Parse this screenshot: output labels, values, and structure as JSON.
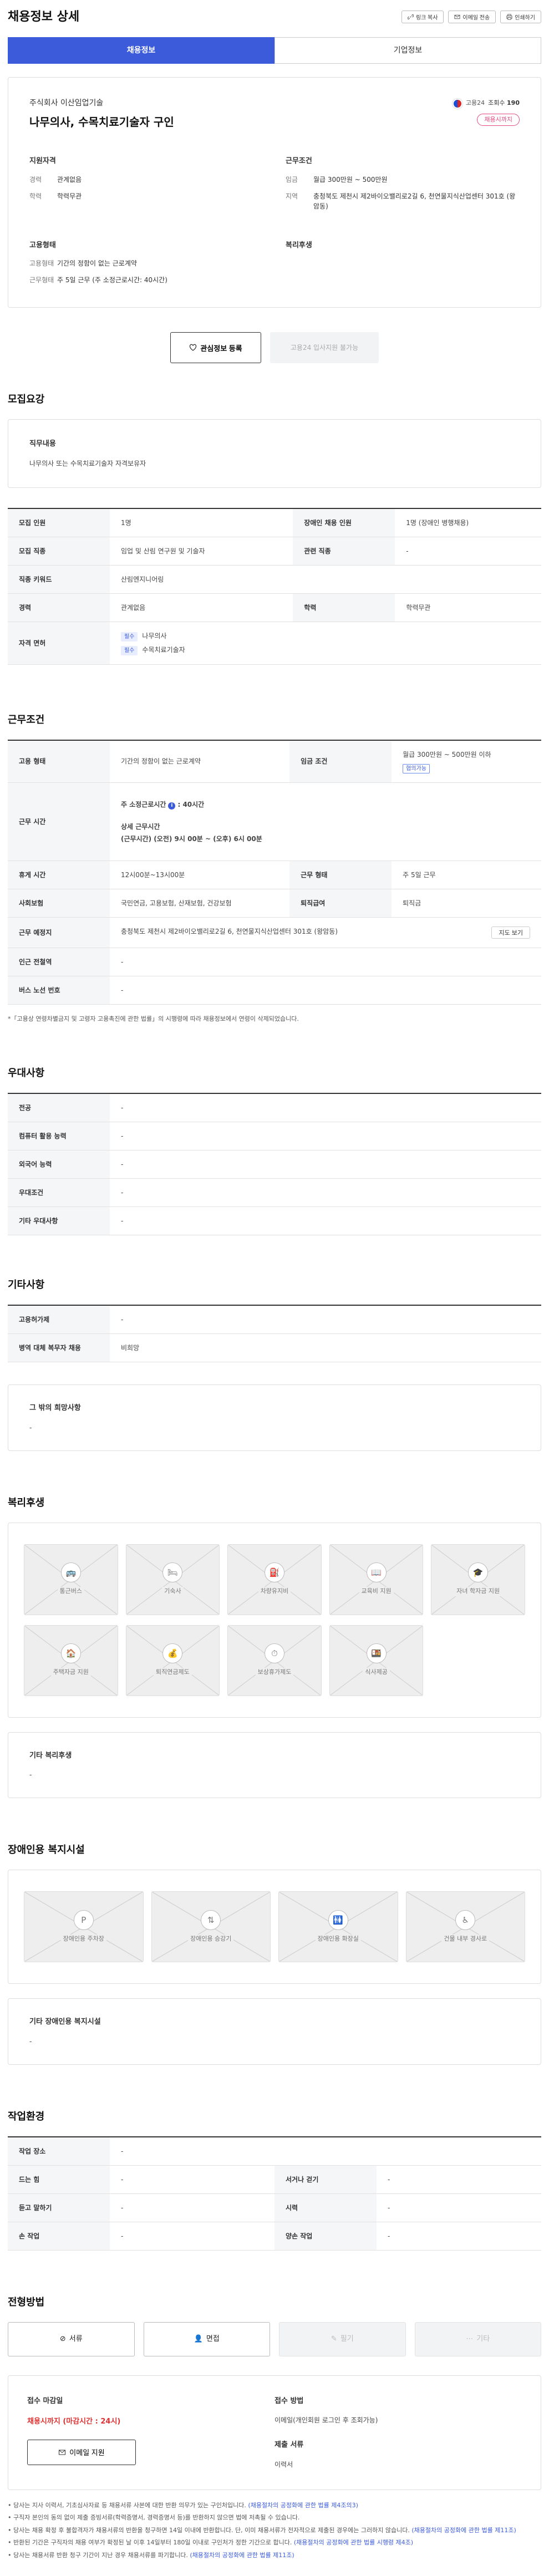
{
  "header": {
    "title": "채용정보 상세",
    "tools": [
      "링크 복사",
      "이메일 전송",
      "인쇄하기"
    ]
  },
  "tabs": [
    "채용정보",
    "기업정보"
  ],
  "summary": {
    "company": "주식회사 이산임업기술",
    "employment_label": "고용24",
    "views_label": "조회수",
    "views": "190",
    "title": "나무의사, 수목치료기술자 구인",
    "badge": "채용시까지",
    "qualification_title": "지원자격",
    "career_k": "경력",
    "career_v": "관계없음",
    "edu_k": "학력",
    "edu_v": "학력무관",
    "conditions_title": "근무조건",
    "wage_k": "임금",
    "wage_v": "월급 300만원 ~ 500만원",
    "region_k": "지역",
    "region_v": "충청북도 제천시 제2바이오밸리로2길 6, 천연물지식산업센터 301호 (왕암동)",
    "emp_title": "고용형태",
    "emptype_k": "고용형태",
    "emptype_v": "기간의 정함이 없는 근로계약",
    "worktype_k": "근무형태",
    "worktype_v": "주 5일 근무 (주 소정근로시간: 40시간)",
    "welfare_title": "복리후생"
  },
  "actions": {
    "favorite": "관심정보 등록",
    "apply24": "고용24 입사지원 불가능"
  },
  "recruit": {
    "section_title": "모집요강",
    "duty_title": "직무내용",
    "duty": "나무의사 또는 수목치료기술자 자격보유자",
    "rows": {
      "count_k": "모집 인원",
      "count_v": "1명",
      "disabled_k": "장애인 채용 인원",
      "disabled_v": "1명 (장애인 병행채용)",
      "job_k": "모집 직종",
      "job_v": "임업 및 산림 연구원 및 기술자",
      "related_k": "관련 직종",
      "related_v": "-",
      "keyword_k": "직종 키워드",
      "keyword_v": "산림엔지니어링",
      "career_k": "경력",
      "career_v": "관계없음",
      "edu_k": "학력",
      "edu_v": "학력무관",
      "license_k": "자격 면허",
      "license_chip": "필수",
      "license_1": "나무의사",
      "license_2": "수목치료기술자"
    }
  },
  "work": {
    "section_title": "근무조건",
    "type_k": "고용 형태",
    "type_v": "기간의 정함이 없는 근로계약",
    "wage_k": "임금 조건",
    "wage_v": "월급 300만원 ~ 500만원 이하",
    "wage_chip": "협의가능",
    "hours_k": "근무 시간",
    "hours_l1_pre": "주 소정근로시간",
    "hours_l1_post": ": 40시간",
    "hours_l2": "상세 근무시간",
    "hours_l3": "(근무시간) (오전) 9시 00분 ~ (오후) 6시 00분",
    "break_k": "휴게 시간",
    "break_v": "12시00분~13시00분",
    "form_k": "근무 형태",
    "form_v": "주 5일 근무",
    "insurance_k": "사회보험",
    "insurance_v": "국민연금, 고용보험, 산재보험, 건강보험",
    "pension_k": "퇴직급여",
    "pension_v": "퇴직금",
    "place_k": "근무 예정지",
    "place_v": "충청북도 제천시 제2바이오밸리로2길 6, 천연물지식산업센터 301호 (왕암동)",
    "map_btn": "지도 보기",
    "subway_k": "인근 전철역",
    "subway_v": "-",
    "bus_k": "버스 노선 번호",
    "bus_v": "-",
    "note": "*「고용상 연령차별금지 및 고령자 고용촉진에 관한 법률」의 시행령에 따라 채용정보에서 연령이 삭제되었습니다."
  },
  "preference": {
    "section_title": "우대사항",
    "rows": [
      {
        "k": "전공",
        "v": "-"
      },
      {
        "k": "컴퓨터 활용 능력",
        "v": "-"
      },
      {
        "k": "외국어 능력",
        "v": "-"
      },
      {
        "k": "우대조건",
        "v": "-"
      },
      {
        "k": "기타 우대사항",
        "v": "-"
      }
    ]
  },
  "other": {
    "section_title": "기타사항",
    "rows": [
      {
        "k": "고용허가제",
        "v": "-"
      },
      {
        "k": "병역 대체 복무자 채용",
        "v": "비희망"
      }
    ],
    "box_title": "그 밖의 희망사항",
    "box_value": "-"
  },
  "welfare": {
    "section_title": "복리후생",
    "tiles": [
      {
        "label": "통근버스",
        "icon": "bus-icon",
        "glyph": "🚌"
      },
      {
        "label": "기숙사",
        "icon": "bed-icon",
        "glyph": "🛏"
      },
      {
        "label": "차량유지비",
        "icon": "fuel-icon",
        "glyph": "⛽"
      },
      {
        "label": "교육비 지원",
        "icon": "book-icon",
        "glyph": "📖"
      },
      {
        "label": "자녀 학자금 지원",
        "icon": "graduation-cap-icon",
        "glyph": "🎓"
      },
      {
        "label": "주택자금 지원",
        "icon": "house-money-icon",
        "glyph": "🏠"
      },
      {
        "label": "퇴직연금제도",
        "icon": "money-bag-icon",
        "glyph": "💰"
      },
      {
        "label": "보상휴가제도",
        "icon": "clock-icon",
        "glyph": "⏱"
      },
      {
        "label": "식사제공",
        "icon": "meal-icon",
        "glyph": "🍱"
      }
    ],
    "box_title": "기타 복리후생",
    "box_value": "-"
  },
  "accessibility": {
    "section_title": "장애인용 복지시설",
    "tiles": [
      {
        "label": "장애인용 주차장",
        "icon": "parking-icon",
        "glyph": "P"
      },
      {
        "label": "장애인용 승강기",
        "icon": "elevator-icon",
        "glyph": "⇅"
      },
      {
        "label": "장애인용 화장실",
        "icon": "restroom-icon",
        "glyph": "🚻"
      },
      {
        "label": "건물 내부 경사로",
        "icon": "ramp-icon",
        "glyph": "♿"
      }
    ],
    "box_title": "기타 장애인용 복지시설",
    "box_value": "-"
  },
  "environment": {
    "section_title": "작업환경",
    "rows": [
      {
        "k1": "작업 장소",
        "v1": "-"
      },
      {
        "k1": "드는 힘",
        "v1": "-",
        "k2": "서거나 걷기",
        "v2": "-"
      },
      {
        "k1": "듣고 말하기",
        "v1": "-",
        "k2": "시력",
        "v2": "-"
      },
      {
        "k1": "손 작업",
        "v1": "-",
        "k2": "양손 작업",
        "v2": "-"
      }
    ]
  },
  "process": {
    "section_title": "전형방법",
    "methods": [
      {
        "label": "서류",
        "icon": "document-icon",
        "enabled": true
      },
      {
        "label": "면접",
        "icon": "interview-icon",
        "enabled": true
      },
      {
        "label": "필기",
        "icon": "pencil-icon",
        "enabled": false
      },
      {
        "label": "기타",
        "icon": "more-icon",
        "enabled": false
      }
    ],
    "deadline_title": "접수 마감일",
    "deadline": "채용시까지 (마감시간 : 24시)",
    "apply_btn": "이메일 지원",
    "method_title": "접수 방법",
    "method_value": "이메일(개인회원 로그인 후 조회가능)",
    "docs_title": "제출 서류",
    "docs_value": "이력서"
  },
  "footnotes": [
    {
      "text": "당사는 지사 이력서, 기초심사자료 등 채용서류 사본에 대한 반환 의무가 있는 구인처입니다.",
      "link": "(채용절차의 공정화에 관한 법률 제4조의3)"
    },
    {
      "text": "구직자 본인의 동의 없이 제출 증빙서류(학력증명서, 경력증명서 등)를 반환하지 않으면 법에 저촉될 수 있습니다.",
      "link": ""
    },
    {
      "text": "당사는 채용 확정 후 불합격자가 채용서류의 반환을 청구하면 14일 이내에 반환합니다. 단, 이미 채용서류가 전자적으로 제출된 경우에는 그러하지 않습니다.",
      "link": "(채용절차의 공정화에 관한 법률 제11조)"
    },
    {
      "text": "반환된 기간은 구직자의 채용 여부가 확정된 날 이후 14일부터 180일 이내로 구인처가 정한 기간으로 합니다.",
      "link": "(채용절차의 공정화에 관한 법률 시행령 제4조)"
    },
    {
      "text": "당사는 채용서류 반환 청구 기간이 지난 경우 채용서류를 파기합니다.",
      "link": "(채용절차의 공정화에 관한 법률 제11조)"
    }
  ]
}
